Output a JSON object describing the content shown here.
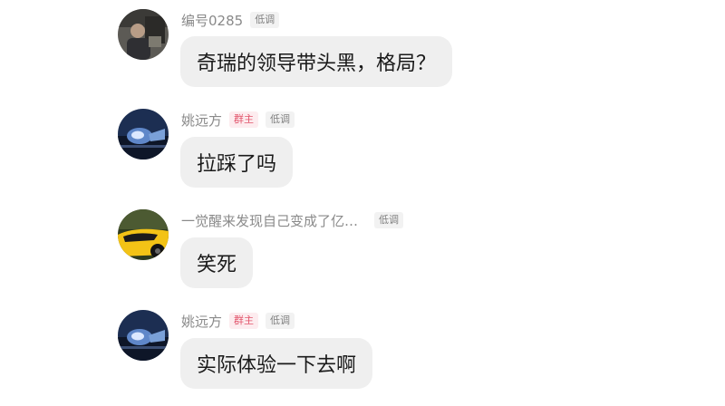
{
  "messages": [
    {
      "name": "编号0285",
      "badges": [
        "低调"
      ],
      "text": "奇瑞的领导带头黑，格局？",
      "avatar": "person-photo-avatar"
    },
    {
      "name": "姚远方",
      "badges": [
        "群主",
        "低调"
      ],
      "text": "拉踩了吗",
      "avatar": "car-headlight-avatar"
    },
    {
      "name": "一觉醒来发现自己变成了亿…",
      "badges": [
        "低调"
      ],
      "text": "笑死",
      "avatar": "yellow-car-avatar"
    },
    {
      "name": "姚远方",
      "badges": [
        "群主",
        "低调"
      ],
      "text": "实际体验一下去啊",
      "avatar": "car-headlight-avatar"
    }
  ],
  "colors": {
    "bubble_bg": "#efefef",
    "owner_tag_bg": "#fdecef",
    "owner_tag_text": "#e2556c",
    "tag_bg": "#f2f2f2",
    "name_text": "#8a8a8a"
  }
}
